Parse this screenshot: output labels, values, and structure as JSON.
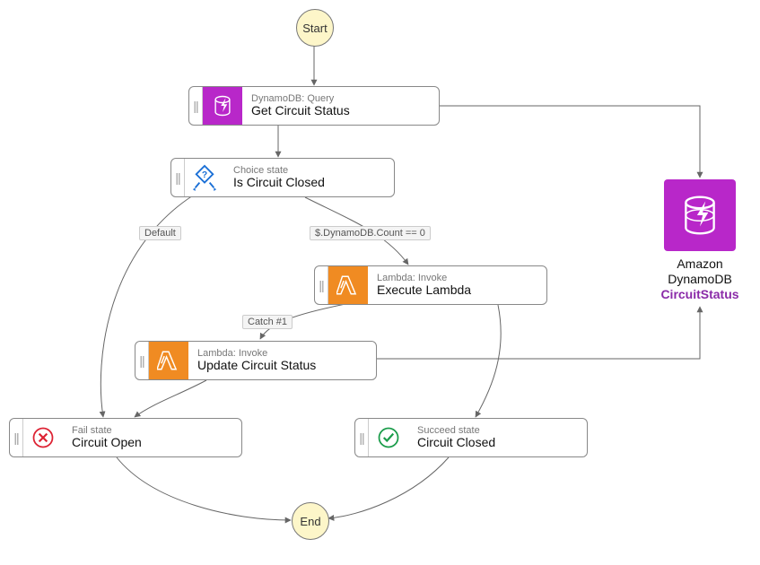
{
  "terminals": {
    "start": "Start",
    "end": "End"
  },
  "nodes": {
    "getCircuit": {
      "sub": "DynamoDB: Query",
      "main": "Get Circuit Status"
    },
    "isClosed": {
      "sub": "Choice state",
      "main": "Is Circuit Closed"
    },
    "execLambda": {
      "sub": "Lambda: Invoke",
      "main": "Execute Lambda"
    },
    "updateCircuit": {
      "sub": "Lambda: Invoke",
      "main": "Update Circuit Status"
    },
    "circuitOpen": {
      "sub": "Fail state",
      "main": "Circuit Open"
    },
    "circuitClosed": {
      "sub": "Succeed state",
      "main": "Circuit Closed"
    }
  },
  "edgeLabels": {
    "default": "Default",
    "countZero": "$.DynamoDB.Count == 0",
    "catch1": "Catch #1"
  },
  "external": {
    "line1": "Amazon",
    "line2": "DynamoDB",
    "line3": "CircuitStatus"
  },
  "chart_data": {
    "type": "flowchart",
    "title": "AWS Step Functions Circuit Breaker State Machine",
    "nodes": [
      {
        "id": "start",
        "type": "start",
        "label": "Start"
      },
      {
        "id": "getCircuit",
        "type": "task",
        "service": "DynamoDB",
        "action": "Query",
        "label": "Get Circuit Status"
      },
      {
        "id": "isClosed",
        "type": "choice",
        "label": "Is Circuit Closed"
      },
      {
        "id": "execLambda",
        "type": "task",
        "service": "Lambda",
        "action": "Invoke",
        "label": "Execute Lambda"
      },
      {
        "id": "updateCircuit",
        "type": "task",
        "service": "Lambda",
        "action": "Invoke",
        "label": "Update Circuit Status"
      },
      {
        "id": "circuitOpen",
        "type": "fail",
        "label": "Circuit Open"
      },
      {
        "id": "circuitClosed",
        "type": "succeed",
        "label": "Circuit Closed"
      },
      {
        "id": "end",
        "type": "end",
        "label": "End"
      },
      {
        "id": "ddbTable",
        "type": "resource",
        "service": "Amazon DynamoDB",
        "label": "CircuitStatus"
      }
    ],
    "edges": [
      {
        "from": "start",
        "to": "getCircuit"
      },
      {
        "from": "getCircuit",
        "to": "isClosed"
      },
      {
        "from": "getCircuit",
        "to": "ddbTable"
      },
      {
        "from": "isClosed",
        "to": "circuitOpen",
        "label": "Default"
      },
      {
        "from": "isClosed",
        "to": "execLambda",
        "label": "$.DynamoDB.Count == 0"
      },
      {
        "from": "execLambda",
        "to": "updateCircuit",
        "label": "Catch #1"
      },
      {
        "from": "execLambda",
        "to": "circuitClosed"
      },
      {
        "from": "updateCircuit",
        "to": "circuitOpen"
      },
      {
        "from": "updateCircuit",
        "to": "ddbTable"
      },
      {
        "from": "circuitOpen",
        "to": "end"
      },
      {
        "from": "circuitClosed",
        "to": "end"
      }
    ]
  }
}
